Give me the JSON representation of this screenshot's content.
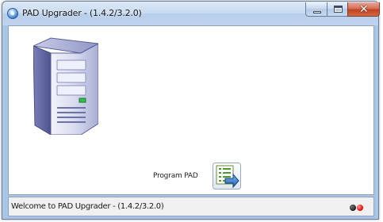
{
  "window": {
    "title": "PAD Upgrader - (1.4.2/3.2.0)"
  },
  "main": {
    "program_button_label": "Program PAD"
  },
  "statusbar": {
    "message": "Welcome to PAD Upgrader - (1.4.2/3.2.0)"
  },
  "icons": {
    "app": "app-icon",
    "server": "server-icon",
    "program": "program-pad-icon"
  },
  "colors": {
    "status_led_1": "#1c1c1c",
    "status_led_2": "#e11111"
  }
}
